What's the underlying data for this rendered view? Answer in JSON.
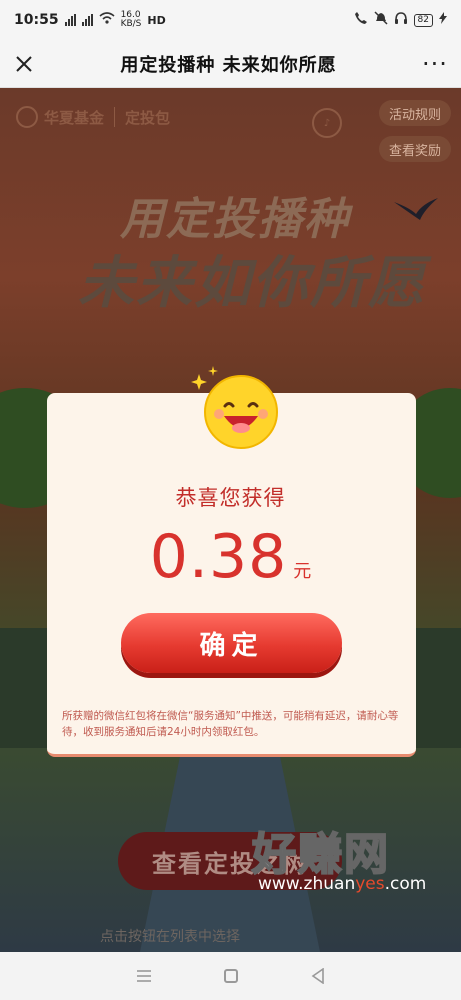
{
  "status_bar": {
    "time": "10:55",
    "net_speed_top": "16.0",
    "net_speed_bottom": "KB/S",
    "hd": "HD",
    "battery": "82"
  },
  "nav": {
    "title": "用定投播种 未来如你所愿",
    "more": "···"
  },
  "scene": {
    "brand_name": "华夏基金",
    "brand_sub": "定投包",
    "rules_label": "活动规则",
    "prize_label": "查看奖励",
    "slogan_line1": "用定投播种",
    "slogan_line2": "未来如你所愿",
    "tree_button": "查看定投之树",
    "hint": "点击按钮在列表中选择"
  },
  "modal": {
    "title": "恭喜您获得",
    "amount": "0.38",
    "unit": "元",
    "confirm_label": "确定",
    "notice": "所获赠的微信红包将在微信“服务通知”中推送，可能稍有延迟，请耐心等待，收到服务通知后请24小时内领取红包。"
  },
  "watermark": {
    "text": "好赚网",
    "url_prefix": "www.zhuan",
    "url_accent": "yes",
    "url_suffix": ".com"
  },
  "colors": {
    "accent_red": "#d8322d",
    "modal_bg": "#fdf4ea"
  }
}
